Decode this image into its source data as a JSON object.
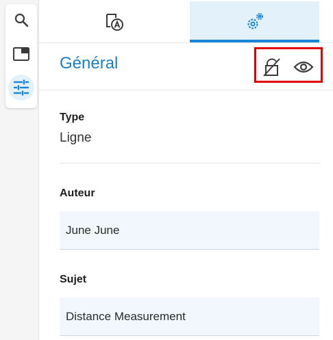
{
  "left_toolbar": {
    "items": [
      {
        "icon": "search-icon",
        "active": false
      },
      {
        "icon": "panel-icon",
        "active": false
      },
      {
        "icon": "sliders-icon",
        "active": true
      }
    ]
  },
  "tabs": [
    {
      "icon": "page-annotation-icon",
      "active": false
    },
    {
      "icon": "gears-icon",
      "active": true
    }
  ],
  "section": {
    "title": "Général",
    "header_icons": [
      "lock-off-icon",
      "eye-icon"
    ]
  },
  "fields": {
    "type": {
      "label": "Type",
      "value": "Ligne"
    },
    "author": {
      "label": "Auteur",
      "value": "June June"
    },
    "subject": {
      "label": "Sujet",
      "value": "Distance Measurement"
    }
  },
  "colors": {
    "accent": "#1a85d6",
    "active_bg": "#e3f1fb",
    "highlight_box": "#e00000",
    "input_bg": "#f1f7fc"
  }
}
